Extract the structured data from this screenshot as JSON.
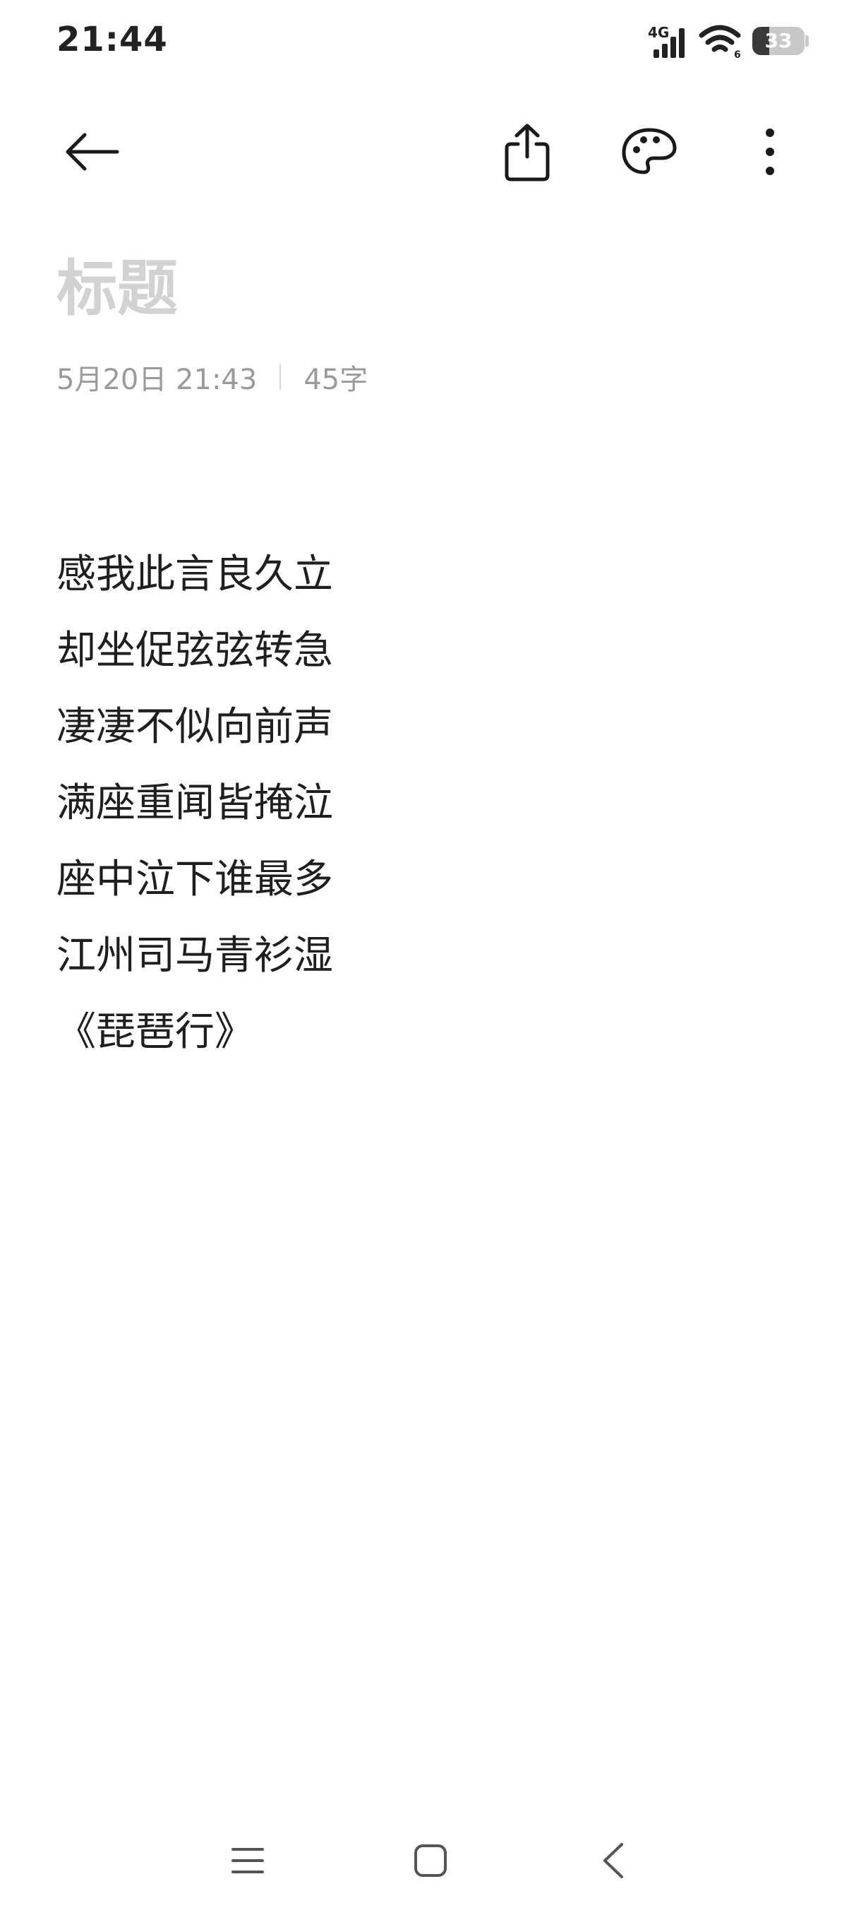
{
  "status_bar": {
    "time": "21:44",
    "network_type": "4G",
    "battery_level": "33",
    "battery_fraction": 0.33
  },
  "toolbar": {
    "back_icon": "arrow-left-icon",
    "share_icon": "share-icon",
    "theme_icon": "palette-icon",
    "more_icon": "more-vertical-icon"
  },
  "note": {
    "title_placeholder": "标题",
    "date": "5月20日 21:43",
    "word_count": "45字",
    "lines": [
      "感我此言良久立",
      "却坐促弦弦转急",
      "凄凄不似向前声",
      "满座重闻皆掩泣",
      "座中泣下谁最多",
      "江州司马青衫湿",
      "《琵琶行》"
    ]
  },
  "nav_bar": {
    "menu_icon": "menu-icon",
    "home_icon": "home-square-icon",
    "back_icon": "back-chevron-icon"
  },
  "colors": {
    "text": "#1f1f1f",
    "title_placeholder": "#d2d2d2",
    "meta": "#9a9a9a",
    "icon": "#1a1a1a"
  }
}
